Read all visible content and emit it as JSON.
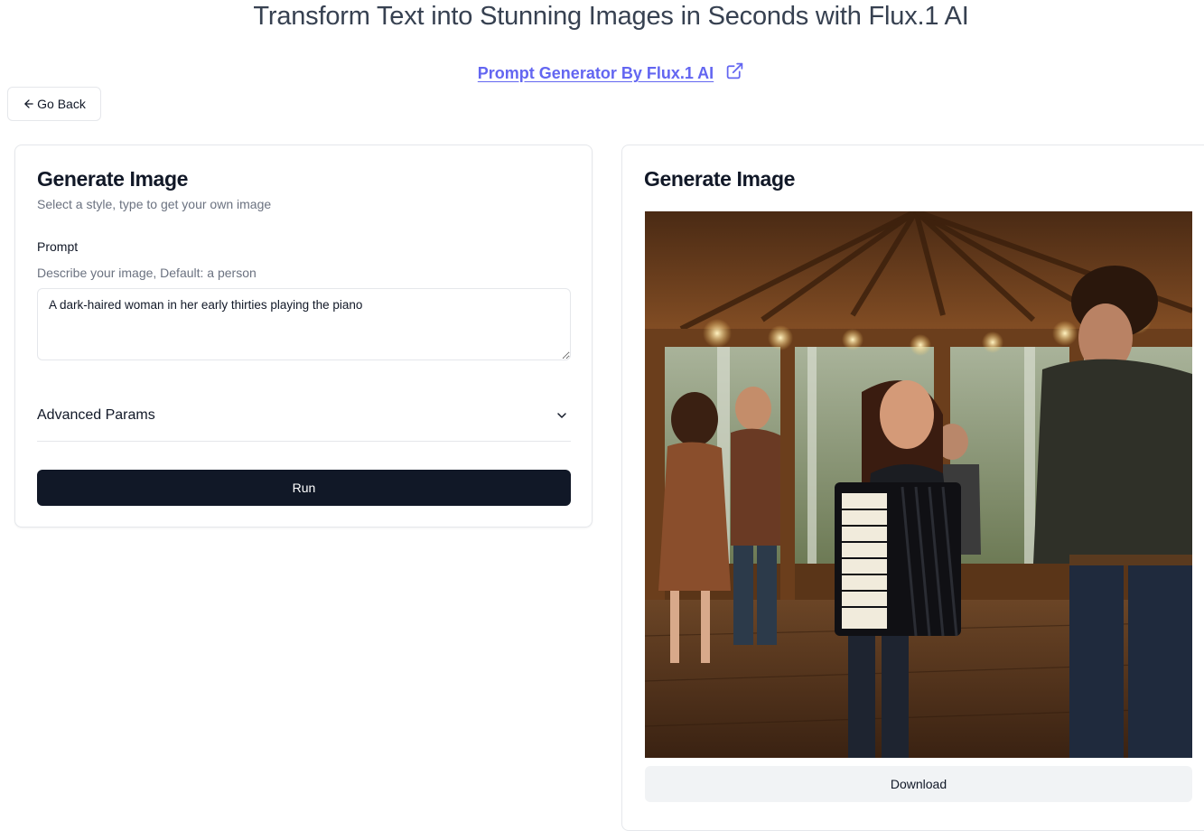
{
  "header": {
    "title": "Transform Text into Stunning Images in Seconds with Flux.1 AI",
    "link_text": "Prompt Generator By Flux.1 AI",
    "link_icon": "external-link-icon",
    "link_color": "#6366f1"
  },
  "nav": {
    "back_label": "Go Back",
    "back_icon": "arrow-left-icon"
  },
  "form": {
    "title": "Generate Image",
    "description": "Select a style, type to get your own image",
    "prompt_label": "Prompt",
    "prompt_help": "Describe your image, Default: a person",
    "prompt_value": "A dark-haired woman in her early thirties playing the piano",
    "advanced_label": "Advanced Params",
    "advanced_icon": "chevron-down-icon",
    "run_label": "Run",
    "run_color": "#111827"
  },
  "result": {
    "title": "Generate Image",
    "download_label": "Download"
  }
}
